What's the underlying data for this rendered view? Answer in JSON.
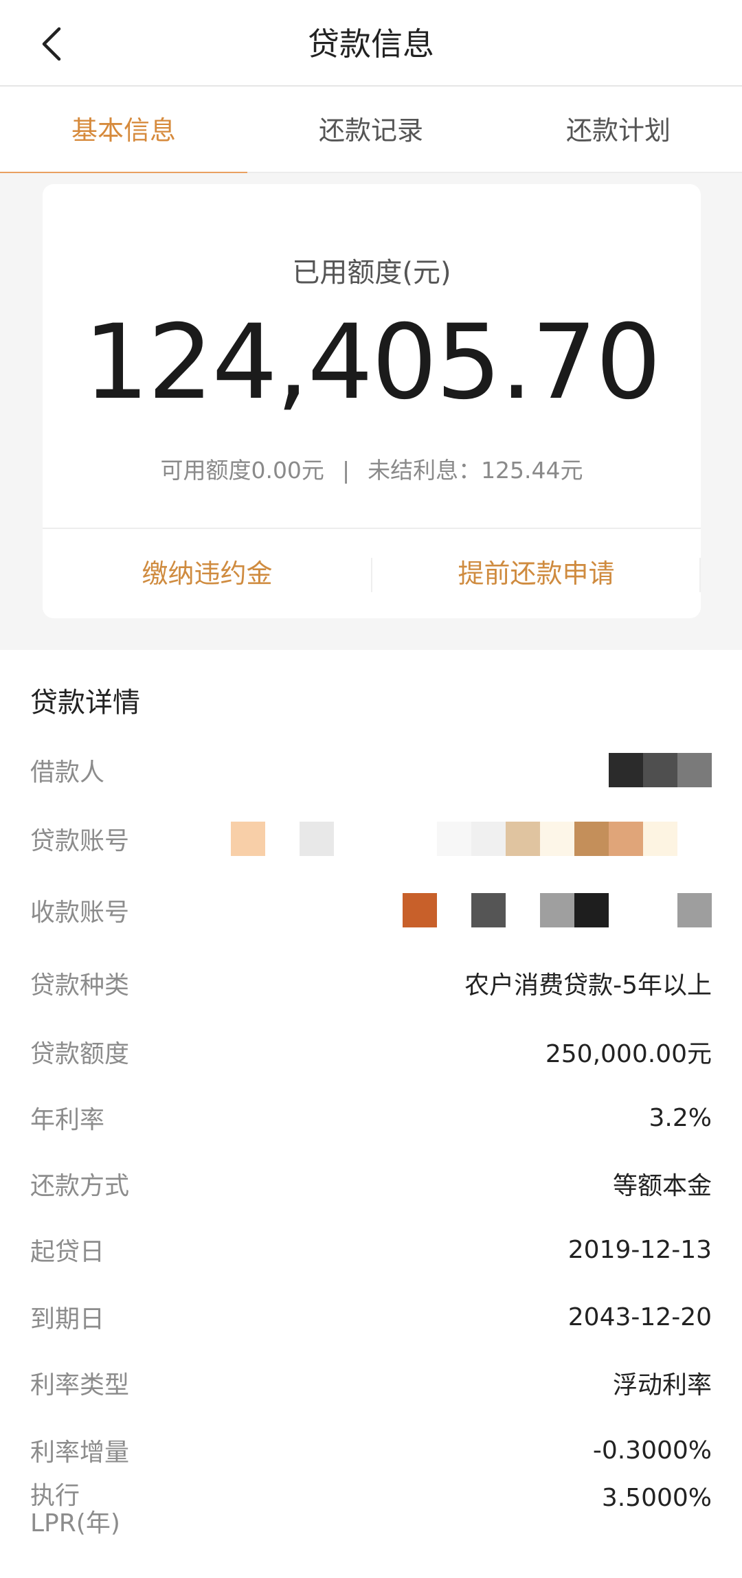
{
  "header": {
    "title": "贷款信息"
  },
  "tabs": [
    {
      "label": "基本信息",
      "active": true
    },
    {
      "label": "还款记录",
      "active": false
    },
    {
      "label": "还款计划",
      "active": false
    }
  ],
  "summary": {
    "label": "已用额度(元)",
    "amount": "124,405.70",
    "available": "可用额度0.00元",
    "separator": "|",
    "interest": "未结利息：125.44元",
    "actions": [
      "缴纳违约金",
      "提前还款申请"
    ]
  },
  "details": {
    "title": "贷款详情",
    "rows": [
      {
        "label": "借款人",
        "value": ""
      },
      {
        "label": "贷款账号",
        "value": ""
      },
      {
        "label": "收款账号",
        "value": ""
      },
      {
        "label": "贷款种类",
        "value": "农户消费贷款-5年以上"
      },
      {
        "label": "贷款额度",
        "value": "250,000.00元"
      },
      {
        "label": "年利率",
        "value": "3.2%"
      },
      {
        "label": "还款方式",
        "value": "等额本金"
      },
      {
        "label": "起贷日",
        "value": "2019-12-13"
      },
      {
        "label": "到期日",
        "value": "2043-12-20"
      },
      {
        "label": "利率类型",
        "value": "浮动利率"
      },
      {
        "label": "利率增量",
        "value": "-0.3000%"
      },
      {
        "label": "执行LPR(年)",
        "label_line1": "执行",
        "label_line2": "LPR(年)",
        "value": "3.5000%"
      }
    ]
  },
  "colors": {
    "accent": "#d68a3c",
    "tab_underline": "#e9a060",
    "background": "#f5f5f5"
  },
  "icons": {
    "back": "chevron-left-icon"
  }
}
